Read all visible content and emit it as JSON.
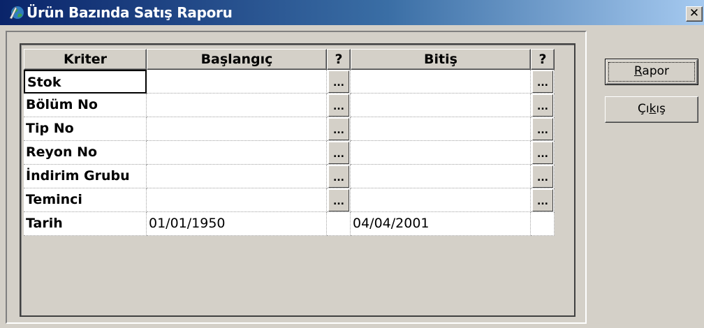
{
  "window": {
    "title": "Ürün Bazında Satış Raporu",
    "close_glyph": "✕"
  },
  "grid": {
    "headers": {
      "kriter": "Kriter",
      "baslangic": "Başlangıç",
      "q1": "?",
      "bitis": "Bitiş",
      "q2": "?"
    },
    "rows": [
      {
        "kriter": "Stok",
        "baslangic": "",
        "bitis": "",
        "has_lookup": true
      },
      {
        "kriter": "Bölüm No",
        "baslangic": "",
        "bitis": "",
        "has_lookup": true
      },
      {
        "kriter": "Tip No",
        "baslangic": "",
        "bitis": "",
        "has_lookup": true
      },
      {
        "kriter": "Reyon No",
        "baslangic": "",
        "bitis": "",
        "has_lookup": true
      },
      {
        "kriter": "İndirim Grubu",
        "baslangic": "",
        "bitis": "",
        "has_lookup": true
      },
      {
        "kriter": "Teminci",
        "baslangic": "",
        "bitis": "",
        "has_lookup": true
      },
      {
        "kriter": "Tarih",
        "baslangic": "01/01/1950",
        "bitis": "04/04/2001",
        "has_lookup": false
      }
    ],
    "lookup_label": "..."
  },
  "buttons": {
    "rapor": "Rapor",
    "cikis": "Çıkış"
  },
  "colors": {
    "titlebar_start": "#0a246a",
    "titlebar_end": "#a6caf0",
    "face": "#d4d0c8"
  }
}
